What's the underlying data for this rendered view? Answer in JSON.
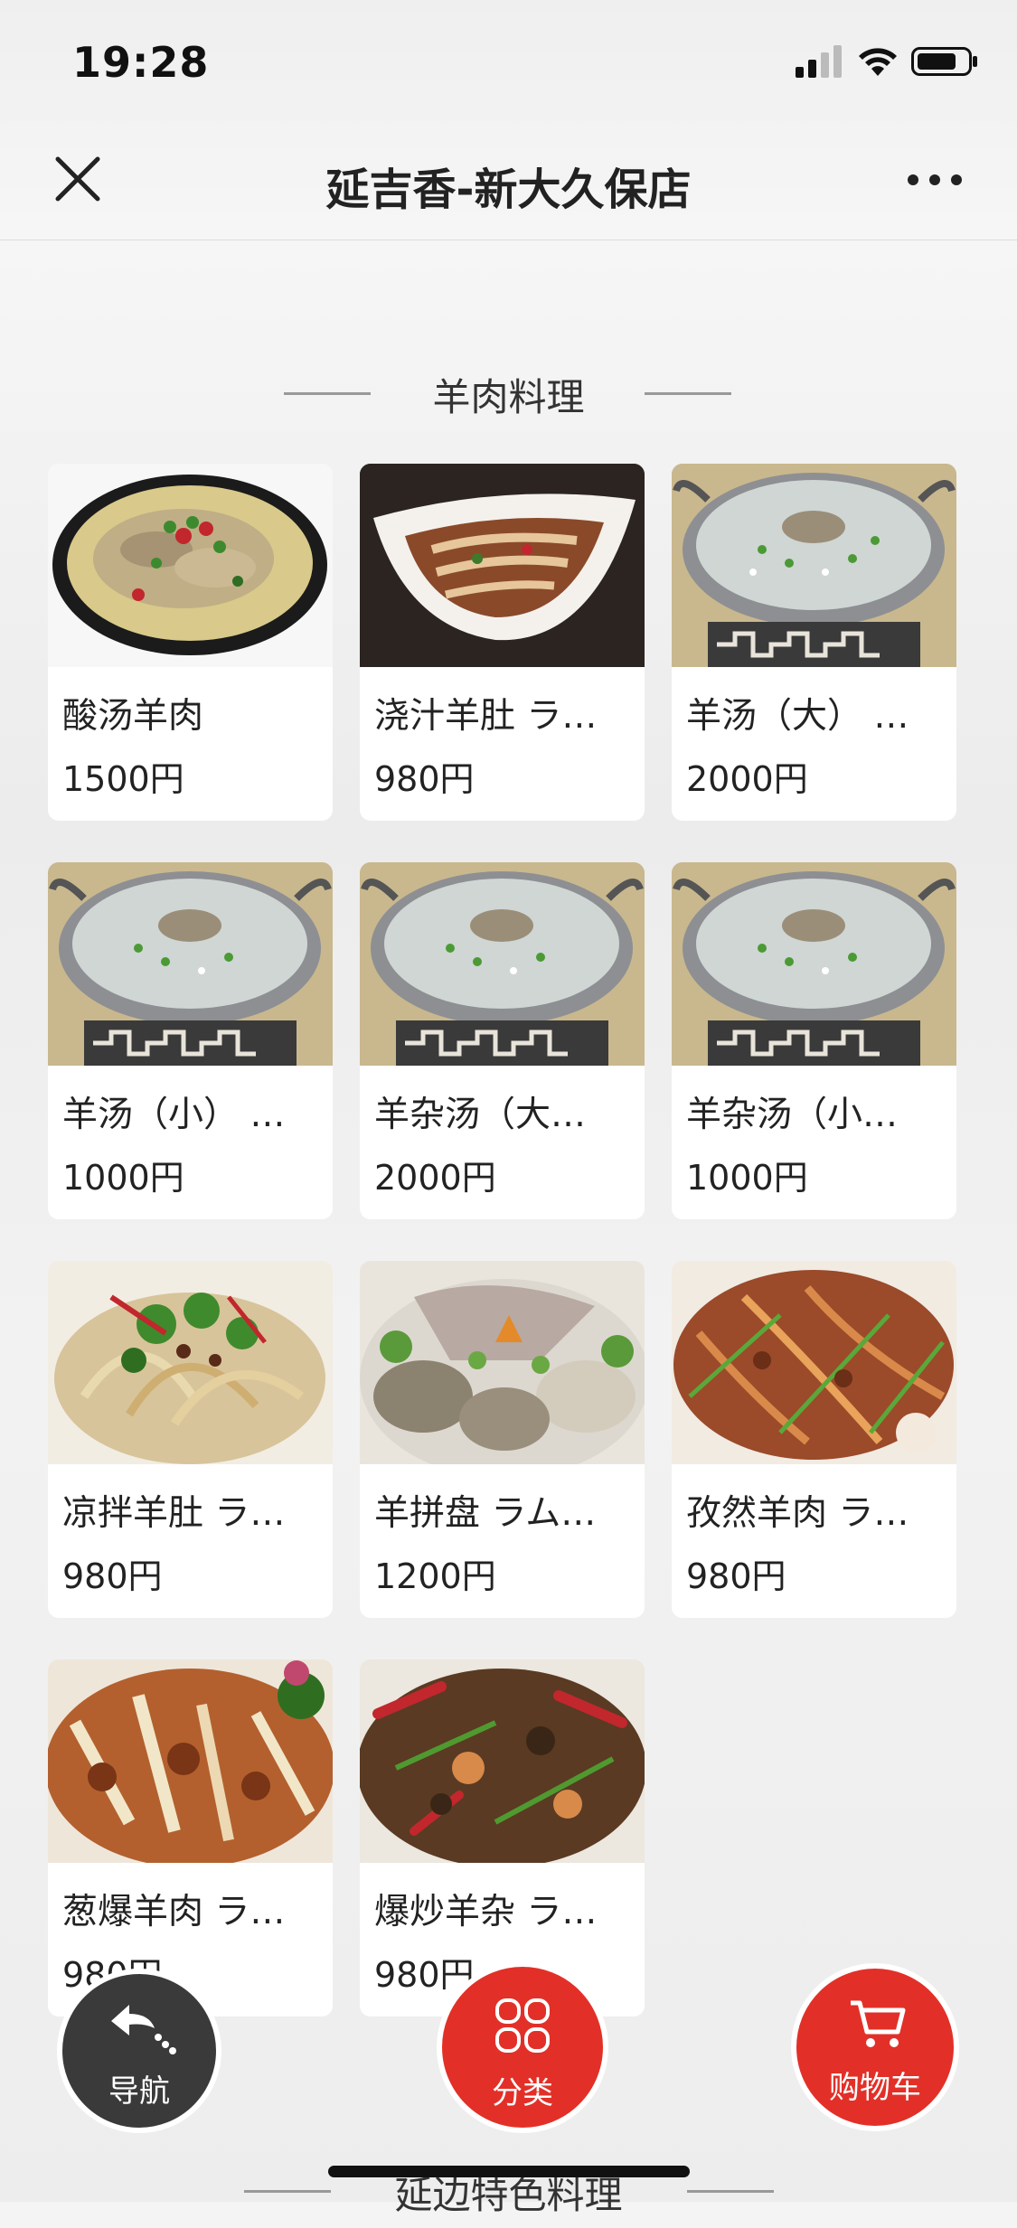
{
  "status": {
    "time": "19:28"
  },
  "header": {
    "title": "延吉香-新大久保店"
  },
  "sections": [
    {
      "title": "羊肉料理",
      "items": [
        {
          "name": "酸汤羊肉",
          "price": "1500円"
        },
        {
          "name": "浇汁羊肚 ラ…",
          "price": "980円"
        },
        {
          "name": "羊汤（大） …",
          "price": "2000円"
        },
        {
          "name": "羊汤（小） …",
          "price": "1000円"
        },
        {
          "name": "羊杂汤（大…",
          "price": "2000円"
        },
        {
          "name": "羊杂汤（小…",
          "price": "1000円"
        },
        {
          "name": "凉拌羊肚 ラ…",
          "price": "980円"
        },
        {
          "name": "羊拼盘 ラム…",
          "price": "1200円"
        },
        {
          "name": "孜然羊肉 ラ…",
          "price": "980円"
        },
        {
          "name": "葱爆羊肉 ラ…",
          "price": "980円"
        },
        {
          "name": "爆炒羊杂 ラ…",
          "price": "980円"
        }
      ]
    },
    {
      "title": "延边特色料理"
    }
  ],
  "floating_buttons": {
    "navigation": "导航",
    "category": "分类",
    "cart": "购物车"
  },
  "colors": {
    "accent": "#e23028",
    "dark_button": "#3a3a3a"
  }
}
